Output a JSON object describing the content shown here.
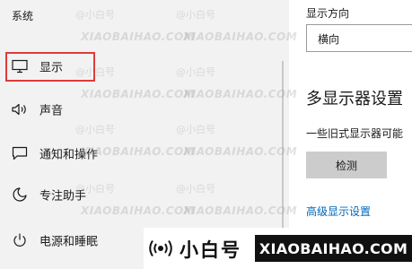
{
  "sidebar": {
    "section_title": "系统",
    "items": [
      {
        "label": "显示",
        "icon": "monitor-icon"
      },
      {
        "label": "声音",
        "icon": "speaker-icon"
      },
      {
        "label": "通知和操作",
        "icon": "notification-icon"
      },
      {
        "label": "专注助手",
        "icon": "moon-icon"
      },
      {
        "label": "电源和睡眠",
        "icon": "power-icon"
      }
    ]
  },
  "main": {
    "orientation_label": "显示方向",
    "orientation_value": "横向",
    "multi_display_title": "多显示器设置",
    "legacy_text": "一些旧式显示器可能",
    "detect_button": "检测",
    "advanced_link": "高级显示设置"
  },
  "watermark": {
    "cn": "@小白号",
    "en": "XIAOBAIHAO.COM"
  },
  "banner": {
    "cn": "小白号",
    "domain": "XIAOBAIHAO.COM"
  },
  "colors": {
    "accent_link": "#0067b8",
    "selection_box": "#e03a3a",
    "pane_bg": "#f2f2f2"
  }
}
